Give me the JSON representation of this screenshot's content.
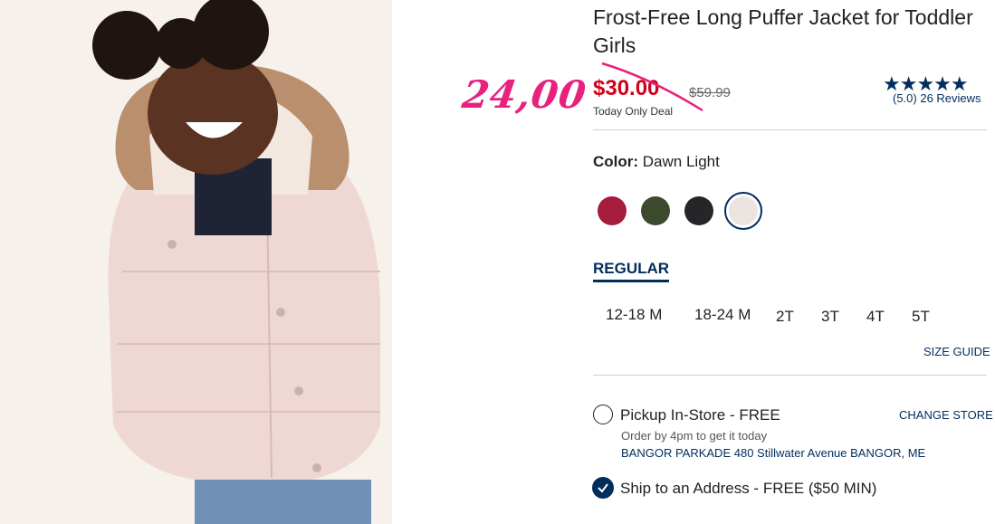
{
  "product": {
    "title": "Frost-Free Long Puffer Jacket for Toddler Girls",
    "handwritten_price": "24,00",
    "sale_price": "$30.00",
    "original_price": "$59.99",
    "deal_note": "Today Only Deal",
    "stars": "★★★★★",
    "rating_text": "(5.0) 26 Reviews"
  },
  "color": {
    "label": "Color:",
    "selected": "Dawn Light",
    "swatches": [
      {
        "name": "burgundy",
        "hex": "#a51c3c"
      },
      {
        "name": "olive",
        "hex": "#3d4a2e"
      },
      {
        "name": "black",
        "hex": "#262628"
      },
      {
        "name": "dawn-light",
        "hex": "#ece4e0"
      }
    ]
  },
  "fit": {
    "tab": "REGULAR"
  },
  "sizes": [
    "12-18 M",
    "18-24 M",
    "2T",
    "3T",
    "4T",
    "5T"
  ],
  "size_guide": "SIZE GUIDE",
  "fulfillment": {
    "pickup_label": "Pickup In-Store - FREE",
    "change_store": "CHANGE STORE",
    "order_note": "Order by 4pm to get it today",
    "store_address": "BANGOR PARKADE 480 Stillwater Avenue  BANGOR, ME",
    "ship_label": "Ship to an Address - FREE ($50 MIN)"
  }
}
